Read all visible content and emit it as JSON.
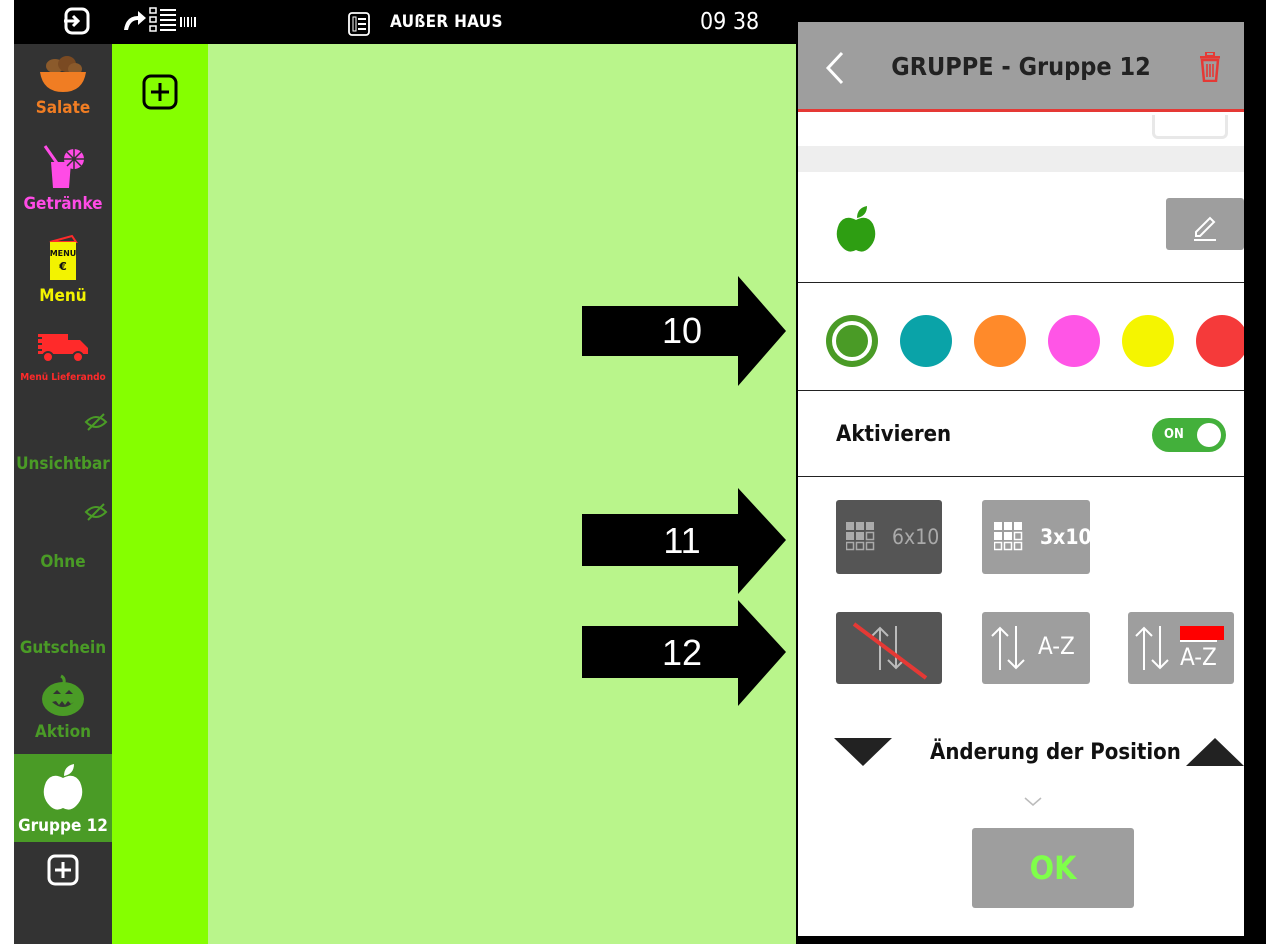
{
  "statusbar": {
    "title": "AUßER HAUS",
    "time": "09 38",
    "icons": [
      "exit-icon",
      "forward-barcode-icon",
      "table-icon"
    ]
  },
  "sidebar": {
    "categories": [
      {
        "label": "Salate",
        "icon": "salad-bowl-icon",
        "color": "#f07d23"
      },
      {
        "label": "Getränke",
        "icon": "drink-icon",
        "color": "#ff4be6"
      },
      {
        "label": "Menü",
        "icon": "menu-card-icon",
        "color": "#f3f300"
      },
      {
        "label": "Menü Lieferando",
        "icon": "delivery-truck-icon",
        "color": "#ff2a2a"
      },
      {
        "label": "Unsichtbar",
        "icon": "hidden-eye-icon",
        "color": "#4a9b26"
      },
      {
        "label": "Ohne",
        "icon": "hidden-eye-icon",
        "color": "#4a9b26"
      },
      {
        "label": "Gutschein",
        "icon": "",
        "color": "#4a9b26"
      },
      {
        "label": "Aktion",
        "icon": "pumpkin-icon",
        "color": "#4a9b26"
      },
      {
        "label": "Gruppe 12",
        "icon": "apple-icon",
        "color": "#ffffff",
        "active": true
      }
    ],
    "add_icon": "add-icon"
  },
  "colors": {
    "column": "#85ff00",
    "main": "#b9f58b",
    "header": "#9e9e9e",
    "accent_red": "#e53935",
    "toggle_on": "#43b03b"
  },
  "dialog": {
    "title": "GRUPPE - Gruppe 12",
    "group_icon": "apple-icon",
    "swatches": [
      "#4a9b26",
      "#0aa3a8",
      "#ff8a2a",
      "#ff55e6",
      "#f5f500",
      "#f53a3a"
    ],
    "selected_swatch": 0,
    "activate_label": "Aktivieren",
    "toggle_state": "ON",
    "layout_buttons": [
      "6x10",
      "3x10"
    ],
    "sort_label": "A-Z",
    "position_label": "Änderung der Position",
    "ok_label": "OK"
  },
  "annotations": [
    "10",
    "11",
    "12"
  ]
}
